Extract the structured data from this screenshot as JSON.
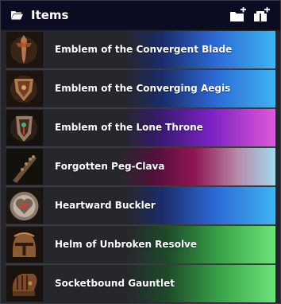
{
  "panel": {
    "title": "Items",
    "header_icon": "folder-open-icon",
    "buttons": [
      {
        "name": "new-folder-button",
        "icon": "folder-plus-icon"
      },
      {
        "name": "new-item-button",
        "icon": "item-plus-icon"
      }
    ]
  },
  "items": [
    {
      "label": "Emblem of the Convergent Blade",
      "icon": "sword-emblem-icon",
      "accent": "#3db4f2"
    },
    {
      "label": "Emblem of the Converging Aegis",
      "icon": "shield-emblem-icon",
      "accent": "#3db4f2"
    },
    {
      "label": "Emblem of the Lone Throne",
      "icon": "throne-emblem-icon",
      "accent": "#e058d8"
    },
    {
      "label": "Forgotten Peg-Clava",
      "icon": "club-icon",
      "accent": "#a3d8f0"
    },
    {
      "label": "Heartward Buckler",
      "icon": "heart-buckler-icon",
      "accent": "#3db4f2"
    },
    {
      "label": "Helm of Unbroken Resolve",
      "icon": "helm-icon",
      "accent": "#6de27a"
    },
    {
      "label": "Socketbound Gauntlet",
      "icon": "gauntlet-icon",
      "accent": "#6de27a"
    }
  ]
}
